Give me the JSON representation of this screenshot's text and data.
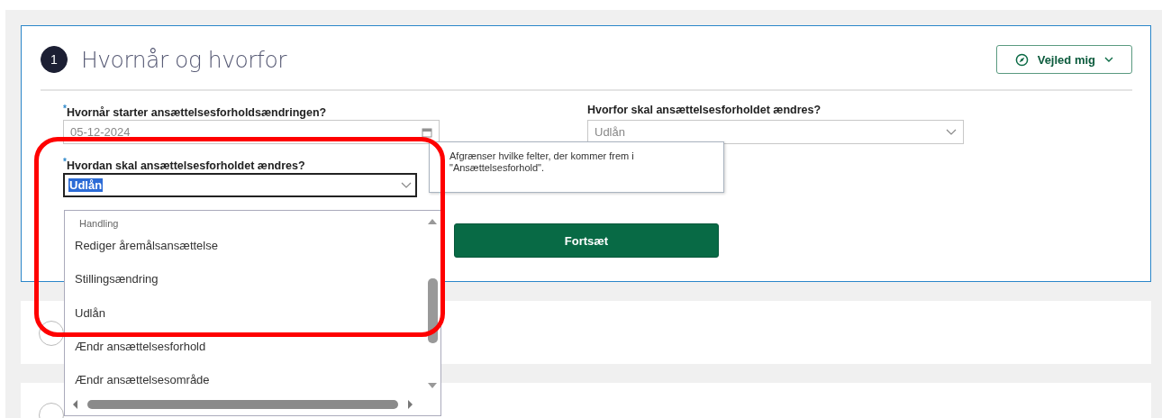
{
  "section": {
    "step": "1",
    "title": "Hvornår og hvorfor",
    "guide_button": "Vejled mig",
    "left_fields": [
      {
        "kind": "date",
        "required_mark": "*",
        "label": "Hvornår starter ansættelsesforholdsændringen?",
        "value": "05-12-2024",
        "focused": false
      },
      {
        "kind": "select",
        "required_mark": "*",
        "label": "Hvordan skal ansættelsesforholdet ændres?",
        "value": "Udlån",
        "focused": true
      }
    ],
    "right_field": {
      "kind": "select",
      "label": "Hvorfor skal ansættelsesforholdet ændres?",
      "value": "Udlån",
      "focused": false
    },
    "continue_button": "Fortsæt"
  },
  "tooltip": "Afgrænser hvilke felter, der kommer frem i \"Ansættelsesforhold\".",
  "dropdown": {
    "group": "Handling",
    "options": [
      {
        "label": "Rediger åremålsansættelse",
        "selected": false
      },
      {
        "label": "Stillingsændring",
        "selected": false
      },
      {
        "label": "Udlån",
        "selected": false
      },
      {
        "label": "Ændr ansættelsesforhold",
        "selected": false
      },
      {
        "label": "Ændr ansættelsesområde",
        "selected": false
      }
    ]
  },
  "collapsed_steps": [
    {
      "kind": "step"
    },
    {
      "kind": "step"
    }
  ]
}
